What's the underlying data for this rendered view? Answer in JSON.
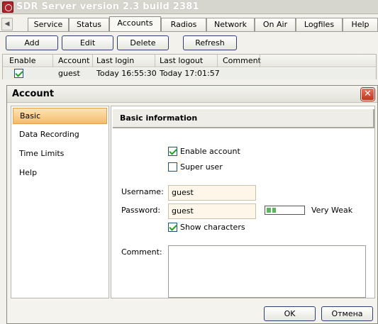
{
  "window": {
    "title": "SDR Server version 2.3 build 2381"
  },
  "tabs": [
    {
      "label": "Service"
    },
    {
      "label": "Status"
    },
    {
      "label": "Accounts"
    },
    {
      "label": "Radios"
    },
    {
      "label": "Network"
    },
    {
      "label": "On Air"
    },
    {
      "label": "Logfiles"
    },
    {
      "label": "Help"
    }
  ],
  "active_tab": "Accounts",
  "toolbar": {
    "add": "Add",
    "edit": "Edit",
    "delete": "Delete",
    "refresh": "Refresh"
  },
  "grid": {
    "columns": [
      "Enable",
      "Account",
      "Last login",
      "Last logout",
      "Comment"
    ],
    "rows": [
      {
        "enabled": true,
        "account": "guest",
        "last_login": "Today 16:55:30",
        "last_logout": "Today 17:01:57",
        "comment": ""
      }
    ]
  },
  "dialog": {
    "title": "Account",
    "close_icon": "close-icon",
    "nav": [
      {
        "label": "Basic"
      },
      {
        "label": "Data Recording"
      },
      {
        "label": "Time Limits"
      },
      {
        "label": "Help"
      }
    ],
    "selected_nav": "Basic",
    "section_title": "Basic information",
    "enable_account": {
      "label": "Enable account",
      "checked": true
    },
    "super_user": {
      "label": "Super user",
      "checked": false
    },
    "username": {
      "label": "Username:",
      "value": "guest"
    },
    "password": {
      "label": "Password:",
      "value": "guest",
      "strength": "Very Weak",
      "strength_level": 0.25
    },
    "show_characters": {
      "label": "Show characters",
      "checked": true
    },
    "comment": {
      "label": "Comment:",
      "value": ""
    },
    "ok": "OK",
    "cancel": "Отмена"
  },
  "colors": {
    "accent_nav": "#f6bb66",
    "close_button": "#c3341c",
    "check": "#21a121"
  }
}
